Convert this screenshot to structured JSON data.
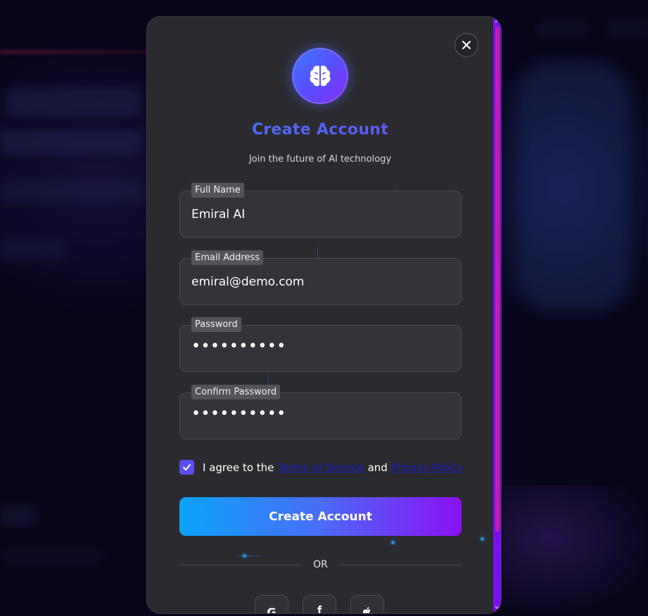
{
  "modal": {
    "title": "Create Account",
    "subtitle": "Join the future of AI technology",
    "fields": [
      {
        "label": "Full Name",
        "value": "Emiral AI",
        "type": "text"
      },
      {
        "label": "Email Address",
        "value": "emiral@demo.com",
        "type": "email"
      },
      {
        "label": "Password",
        "value": "••••••••••",
        "type": "password"
      },
      {
        "label": "Confirm Password",
        "value": "••••••••••",
        "type": "password"
      }
    ],
    "terms": {
      "checked": true,
      "prefix": "I agree to the",
      "link1": "Terms of Service",
      "middle": "and",
      "link2": "Privacy Policy"
    },
    "submit_label": "Create Account",
    "divider_label": "OR",
    "social": [
      {
        "icon": "google-icon",
        "glyph": "G"
      },
      {
        "icon": "facebook-icon",
        "glyph": "f"
      },
      {
        "icon": "apple-icon",
        "glyph": "apple"
      }
    ]
  },
  "colors": {
    "title_gradient": [
      "#3f7bf5",
      "#6a4af2"
    ],
    "button_gradient": [
      "#0aa3f8",
      "#8b10f5"
    ],
    "checkbox": "#5b4ef0",
    "link": "#1a1ec9",
    "scrollbar_track": "#7a10f0",
    "scrollbar_thumb": "#c41dae"
  }
}
